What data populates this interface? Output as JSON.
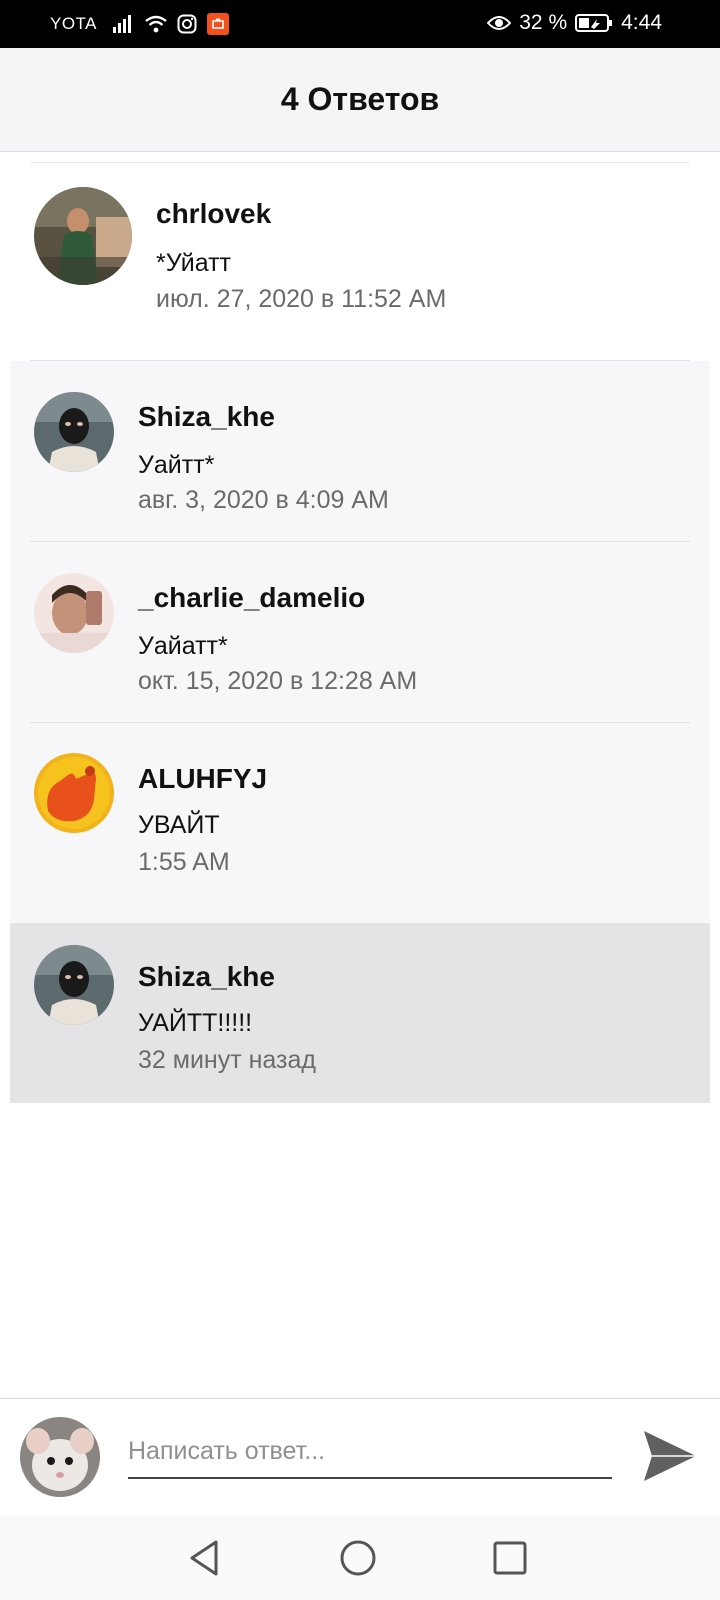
{
  "status_bar": {
    "carrier": "YOTA",
    "battery": "32 %",
    "time": "4:44",
    "icons": [
      "signal-icon",
      "wifi-icon",
      "instagram-icon",
      "app-icon",
      "eye-icon",
      "battery-icon"
    ]
  },
  "header": {
    "title": "4 Ответов"
  },
  "comments": [
    {
      "username": "chrlovek",
      "text": "*Уйатт",
      "time": "июл. 27, 2020 в 11:52 AM"
    },
    {
      "username": "Shiza_khe",
      "text": "Уайтт*",
      "time": "авг. 3, 2020 в 4:09 AM"
    },
    {
      "username": "_charlie_damelio",
      "text": "Уайатт*",
      "time": "окт. 15, 2020 в 12:28 AM"
    },
    {
      "username": "ALUHFYJ",
      "text": "УВАЙТ",
      "time": "1:55 AM"
    },
    {
      "username": "Shiza_khe",
      "text": "УАЙТТ!!!!!",
      "time": "32 минут назад"
    }
  ],
  "reply": {
    "placeholder": "Написать ответ..."
  },
  "colors": {
    "header_bg": "#f5f4f6",
    "reply_bg": "#f7f6f8",
    "highlight_bg": "#e4e3e6",
    "time_text": "#6b6b6b"
  }
}
